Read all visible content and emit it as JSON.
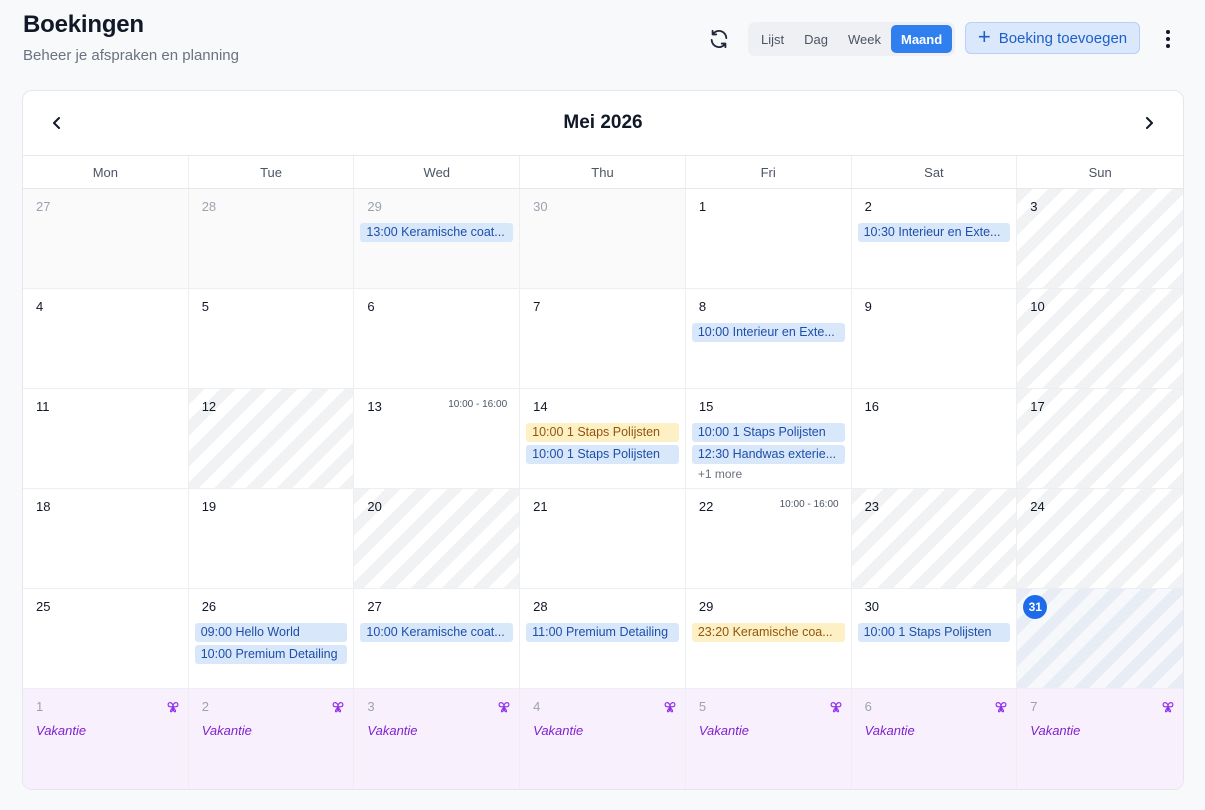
{
  "header": {
    "title": "Boekingen",
    "subtitle": "Beheer je afspraken en planning",
    "views": [
      "Lijst",
      "Dag",
      "Week",
      "Maand"
    ],
    "active_view": "Maand",
    "add_label": "Boeking toevoegen"
  },
  "calendar": {
    "month_title": "Mei 2026",
    "weekdays": [
      "Mon",
      "Tue",
      "Wed",
      "Thu",
      "Fri",
      "Sat",
      "Sun"
    ],
    "vacation_label": "Vakantie",
    "weeks": [
      [
        {
          "day": "27",
          "other": true
        },
        {
          "day": "28",
          "other": true
        },
        {
          "day": "29",
          "other": true,
          "events": [
            {
              "text": "13:00 Keramische coat...",
              "color": "blue"
            }
          ]
        },
        {
          "day": "30",
          "other": true
        },
        {
          "day": "1"
        },
        {
          "day": "2",
          "events": [
            {
              "text": "10:30 Interieur en Exte...",
              "color": "blue"
            }
          ]
        },
        {
          "day": "3",
          "closed": true
        }
      ],
      [
        {
          "day": "4"
        },
        {
          "day": "5"
        },
        {
          "day": "6"
        },
        {
          "day": "7"
        },
        {
          "day": "8",
          "events": [
            {
              "text": "10:00 Interieur en Exte...",
              "color": "blue"
            }
          ]
        },
        {
          "day": "9"
        },
        {
          "day": "10",
          "closed": true
        }
      ],
      [
        {
          "day": "11"
        },
        {
          "day": "12",
          "closed": true
        },
        {
          "day": "13",
          "hours": "10:00 - 16:00"
        },
        {
          "day": "14",
          "events": [
            {
              "text": "10:00 1 Staps Polijsten",
              "color": "yellow"
            },
            {
              "text": "10:00 1 Staps Polijsten",
              "color": "blue"
            }
          ]
        },
        {
          "day": "15",
          "events": [
            {
              "text": "10:00 1 Staps Polijsten",
              "color": "blue"
            },
            {
              "text": "12:30 Handwas exterie...",
              "color": "blue"
            }
          ],
          "more": "+1 more"
        },
        {
          "day": "16"
        },
        {
          "day": "17",
          "closed": true
        }
      ],
      [
        {
          "day": "18"
        },
        {
          "day": "19"
        },
        {
          "day": "20",
          "closed": true
        },
        {
          "day": "21"
        },
        {
          "day": "22",
          "hours": "10:00 - 16:00"
        },
        {
          "day": "23",
          "closed": true
        },
        {
          "day": "24",
          "closed": true
        }
      ],
      [
        {
          "day": "25"
        },
        {
          "day": "26",
          "events": [
            {
              "text": "09:00 Hello World",
              "color": "blue"
            },
            {
              "text": "10:00 Premium Detailing",
              "color": "blue"
            }
          ]
        },
        {
          "day": "27",
          "events": [
            {
              "text": "10:00 Keramische coat...",
              "color": "blue"
            }
          ]
        },
        {
          "day": "28",
          "events": [
            {
              "text": "11:00 Premium Detailing",
              "color": "blue"
            }
          ]
        },
        {
          "day": "29",
          "events": [
            {
              "text": "23:20 Keramische coa...",
              "color": "yellow"
            }
          ]
        },
        {
          "day": "30",
          "events": [
            {
              "text": "10:00 1 Staps Polijsten",
              "color": "blue"
            }
          ]
        },
        {
          "day": "31",
          "today": true,
          "closed": true
        }
      ],
      [
        {
          "day": "1",
          "vacation": true
        },
        {
          "day": "2",
          "vacation": true
        },
        {
          "day": "3",
          "vacation": true
        },
        {
          "day": "4",
          "vacation": true
        },
        {
          "day": "5",
          "vacation": true
        },
        {
          "day": "6",
          "vacation": true
        },
        {
          "day": "7",
          "vacation": true
        }
      ]
    ]
  }
}
